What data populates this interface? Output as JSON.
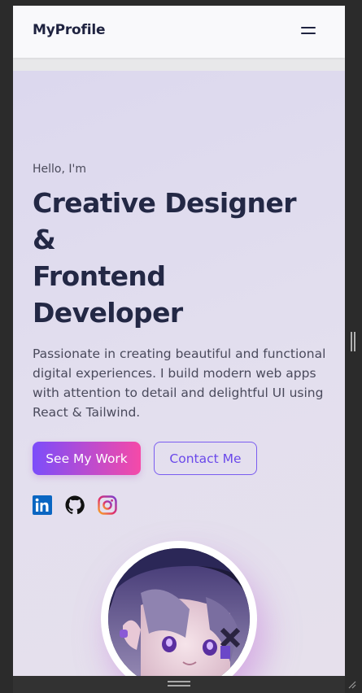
{
  "navbar": {
    "brand": "MyProfile",
    "menu_icon": "hamburger-menu-icon"
  },
  "hero": {
    "greeting": "Hello, I'm",
    "headline_lines": [
      "Creative Designer",
      "&",
      "Frontend",
      "Developer"
    ],
    "description": "Passionate in creating beautiful and functional digital experiences. I build modern web apps with attention to detail and delightful UI using React & Tailwind.",
    "primary_button": "See My Work",
    "secondary_button": "Contact Me",
    "social_icons": [
      "linkedin-icon",
      "github-icon",
      "instagram-icon"
    ]
  },
  "colors": {
    "brand_text": "#1f2340",
    "accent_purple": "#7c4dfa",
    "accent_pink": "#f54aa8",
    "hero_bg": "#dfdbee"
  }
}
